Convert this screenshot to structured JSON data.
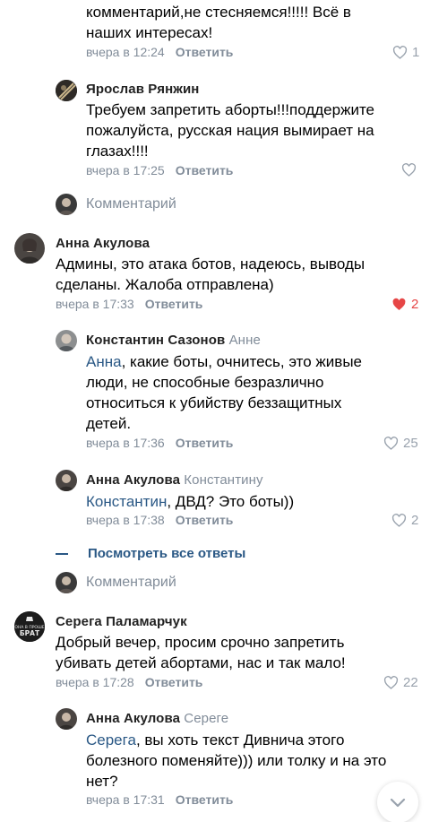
{
  "comments": {
    "c0": {
      "text_line1": "комментарий,не стесняемся!!!!! Всё в",
      "text_line2": "наших интересах!",
      "time": "вчера в 12:24",
      "reply": "Ответить",
      "likes": "1"
    },
    "c1": {
      "author": "Ярослав Рянжин",
      "text_line1": "Требуем запретить аборты!!!поддержите",
      "text_line2": "пожалуйста, русская нация вымирает на",
      "text_line3": "глазах!!!!",
      "time": "вчера в 17:25",
      "reply": "Ответить"
    },
    "placeholder1": "Комментарий",
    "c2": {
      "author": "Анна Акулова",
      "text_line1": "Админы, это атака ботов, надеюсь, выводы",
      "text_line2": "сделаны. Жалоба отправлена)",
      "time": "вчера в 17:33",
      "reply": "Ответить",
      "likes": "2"
    },
    "c3": {
      "author": "Константин Сазонов",
      "reply_to": "Анне",
      "mention": "Анна",
      "text_line1": ", какие боты, очнитесь, это живые",
      "text_line2": "люди, не способные безразлично",
      "text_line3": "относиться к убийству беззащитных",
      "text_line4": "детей.",
      "time": "вчера в 17:36",
      "reply": "Ответить",
      "likes": "25"
    },
    "c4": {
      "author": "Анна Акулова",
      "reply_to": "Константину",
      "mention": "Константин",
      "text_line1": ", ДВД? Это боты))",
      "time": "вчера в 17:38",
      "reply": "Ответить",
      "likes": "2"
    },
    "show_all": "Посмотреть все ответы",
    "placeholder2": "Комментарий",
    "c5": {
      "author": "Серега Паламарчук",
      "avatar_text_1": "ОНА В ПРОШЕ",
      "avatar_text_2": "БРАТ",
      "text_line1": "Добрый вечер, просим срочно запретить",
      "text_line2": "убивать детей абортами, нас и так мало!",
      "time": "вчера в 17:28",
      "reply": "Ответить",
      "likes": "22"
    },
    "c6": {
      "author": "Анна Акулова",
      "reply_to": "Сереге",
      "mention": "Серега",
      "text_line1": ", вы хоть текст Дивнича этого",
      "text_line2": "болезного поменяйте))) или толку и на это",
      "text_line3": "нет?",
      "time": "вчера в 17:31",
      "reply": "Ответить"
    }
  },
  "colors": {
    "link": "#2a5885",
    "meta": "#818c99",
    "liked": "#e64646"
  },
  "icons": [
    "heart-icon",
    "chevron-down-icon"
  ]
}
